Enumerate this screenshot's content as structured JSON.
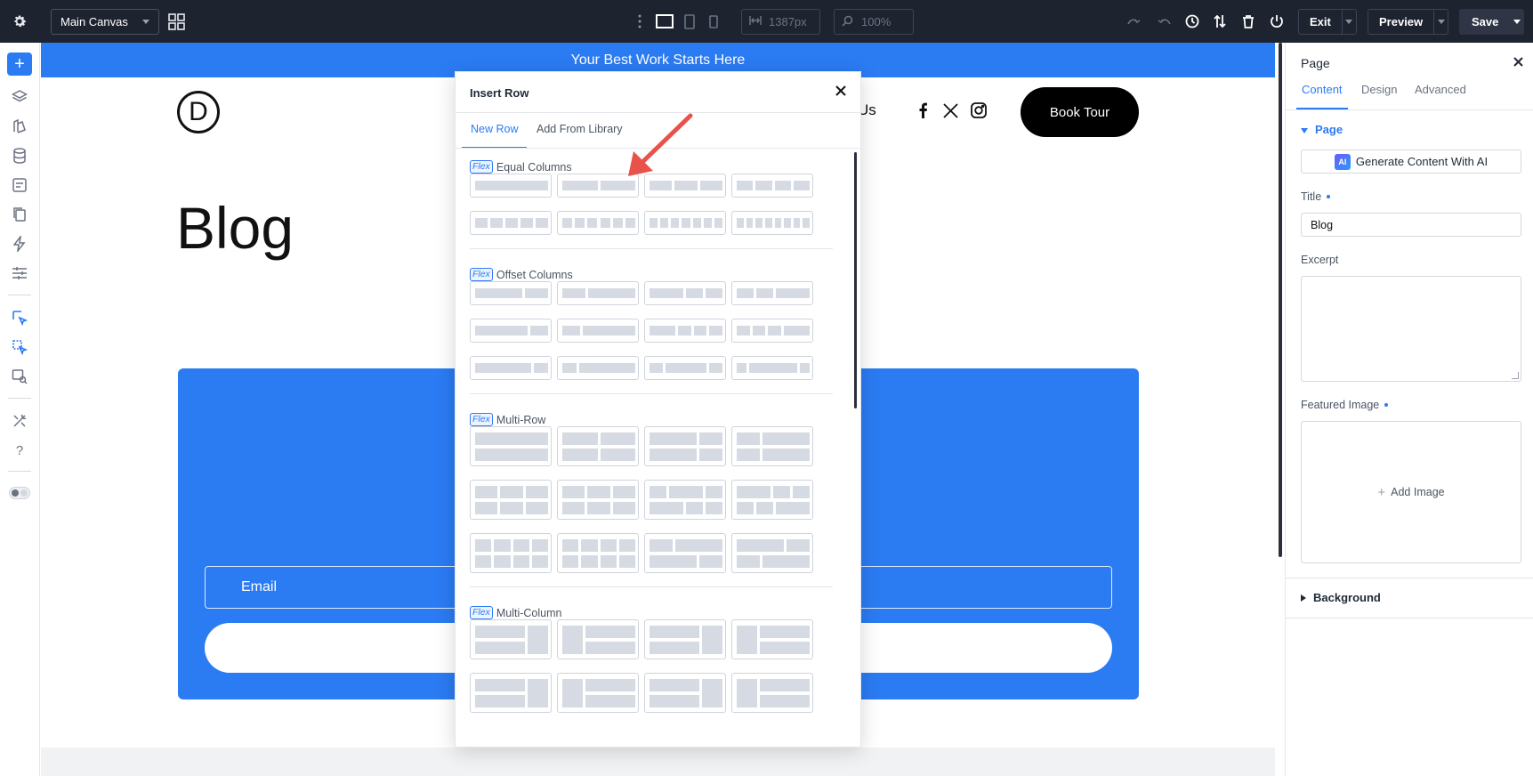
{
  "topbar": {
    "canvas_select": "Main Canvas",
    "width_value": "1387px",
    "zoom_value": "100%",
    "exit_label": "Exit",
    "preview_label": "Preview",
    "save_label": "Save"
  },
  "site": {
    "promo_text": "Your Best Work Starts Here",
    "logo_letter": "D",
    "nav_partial": "Us",
    "book_button": "Book Tour",
    "page_heading": "Blog",
    "email_placeholder": "Email"
  },
  "modal": {
    "title": "Insert Row",
    "tabs": [
      "New Row",
      "Add From Library"
    ],
    "active_tab": "New Row",
    "flex_badge": "Flex",
    "sections": [
      {
        "name": "Equal Columns",
        "tiles": 8
      },
      {
        "name": "Offset Columns",
        "tiles": 12
      },
      {
        "name": "Multi-Row",
        "tiles": 12
      },
      {
        "name": "Multi-Column",
        "tiles": 8
      }
    ]
  },
  "panel": {
    "title": "Page",
    "tabs": [
      "Content",
      "Design",
      "Advanced"
    ],
    "active_tab": "Content",
    "page_section": "Page",
    "ai_button": "Generate Content With AI",
    "ai_badge": "AI",
    "title_label": "Title",
    "title_value": "Blog",
    "excerpt_label": "Excerpt",
    "featured_label": "Featured Image",
    "add_image": "Add Image",
    "background_section": "Background"
  },
  "colors": {
    "accent": "#2b7bf3",
    "topbar_bg": "#1e2330",
    "annotation_arrow": "#e8524a"
  }
}
